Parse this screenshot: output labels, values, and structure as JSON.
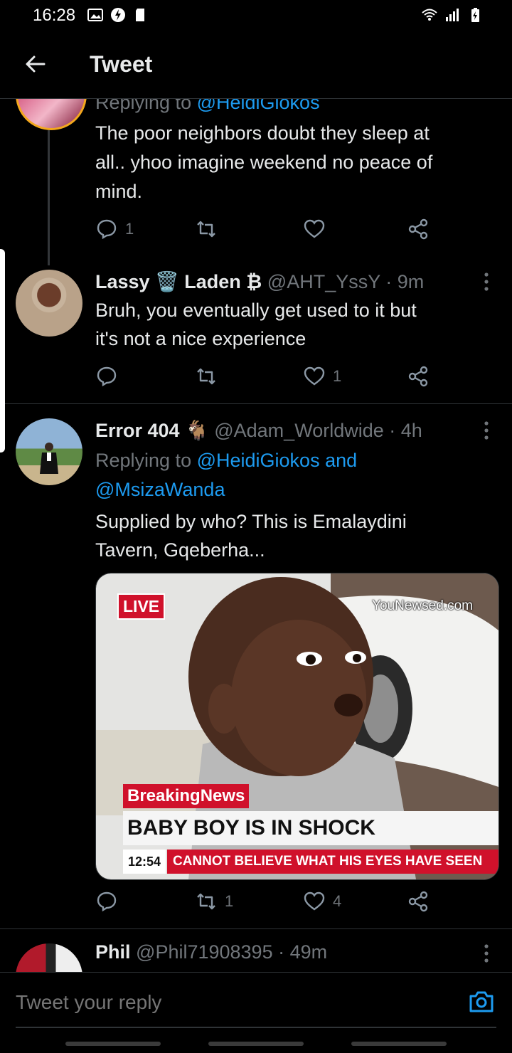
{
  "status_bar": {
    "time": "16:28"
  },
  "header": {
    "title": "Tweet"
  },
  "tweets": [
    {
      "replying_label": "Replying to",
      "replying_handle": "@HeidiGiokos",
      "lines": [
        "The poor neighbors doubt they sleep at",
        "all.. yhoo imagine weekend no peace of",
        "mind."
      ],
      "reply_count": "1",
      "retweet_count": "",
      "like_count": ""
    },
    {
      "name_part1": "Lassy",
      "name_part2": "Laden",
      "name_emoji": "🗑️",
      "name_symbol": "₿",
      "handle": "@AHT_YssY",
      "dot": "·",
      "time": "9m",
      "lines": [
        "Bruh, you eventually get used to it but",
        "it's not a nice experience"
      ],
      "reply_count": "",
      "retweet_count": "",
      "like_count": "1"
    },
    {
      "name": "Error 404",
      "name_emoji": "🐐",
      "handle": "@Adam_Worldwide",
      "dot": "·",
      "time": "4h",
      "replying_label": "Replying to",
      "replying_handle1": "@HeidiGiokos",
      "replying_and": "and",
      "replying_handle2": "@MsizaWanda",
      "lines": [
        "Supplied by who? This is Emalaydini",
        "Tavern, Gqeberha..."
      ],
      "media": {
        "live": "LIVE",
        "watermark": "YouNewsed.com",
        "breaking": "BreakingNews",
        "headline": "BABY BOY IS IN SHOCK",
        "clock": "12:54",
        "ticker": "CANNOT BELIEVE WHAT HIS EYES HAVE SEEN"
      },
      "reply_count": "",
      "retweet_count": "1",
      "like_count": "4"
    },
    {
      "name": "Phil",
      "handle": "@Phil71908395",
      "dot": "·",
      "time": "49m"
    }
  ],
  "reply_bar": {
    "placeholder": "Tweet your reply"
  },
  "colors": {
    "accent": "#1d9bf0",
    "background": "#000000",
    "muted": "#71767b",
    "divider": "#2f3336",
    "live_red": "#d0112b"
  }
}
